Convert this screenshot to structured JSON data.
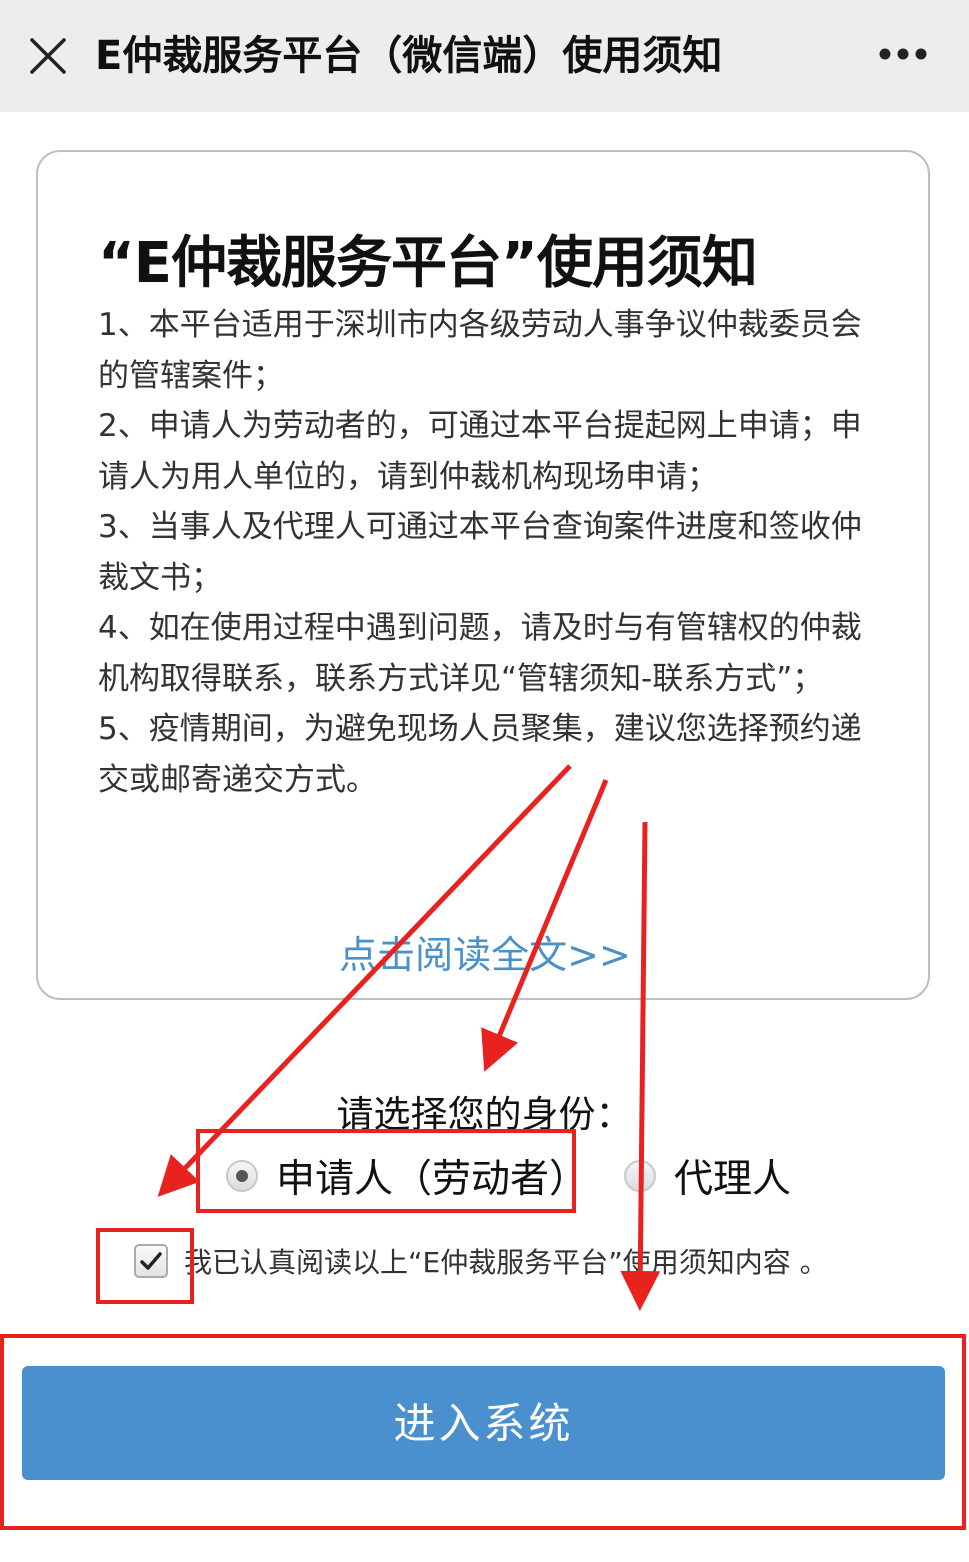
{
  "header": {
    "title": "E仲裁服务平台（微信端）使用须知",
    "close_icon": "close-icon",
    "more_icon": "more-icon"
  },
  "notice": {
    "heading": "“E仲裁服务平台”使用须知",
    "items": [
      "1、本平台适用于深圳市内各级劳动人事争议仲裁委员会的管辖案件；",
      "2、申请人为劳动者的，可通过本平台提起网上申请；申请人为用人单位的，请到仲裁机构现场申请；",
      "3、当事人及代理人可通过本平台查询案件进度和签收仲裁文书；",
      "4、如在使用过程中遇到问题，请及时与有管辖权的仲裁机构取得联系，联系方式详见“管辖须知-联系方式”；",
      "5、疫情期间，为避免现场人员聚集，建议您选择预约递交或邮寄递交方式。"
    ],
    "read_more": "点击阅读全文>>"
  },
  "identity": {
    "label": "请选择您的身份：",
    "options": [
      {
        "label": "申请人（劳动者）",
        "selected": true
      },
      {
        "label": "代理人",
        "selected": false
      }
    ]
  },
  "agreement": {
    "text": "我已认真阅读以上“E仲裁服务平台”使用须知内容 。",
    "checked": true
  },
  "enter_button": {
    "label": "进入系统"
  },
  "colors": {
    "link": "#4a90c9",
    "button": "#4a90cf",
    "annotation": "#e8231f",
    "header_bg": "#ededed"
  }
}
